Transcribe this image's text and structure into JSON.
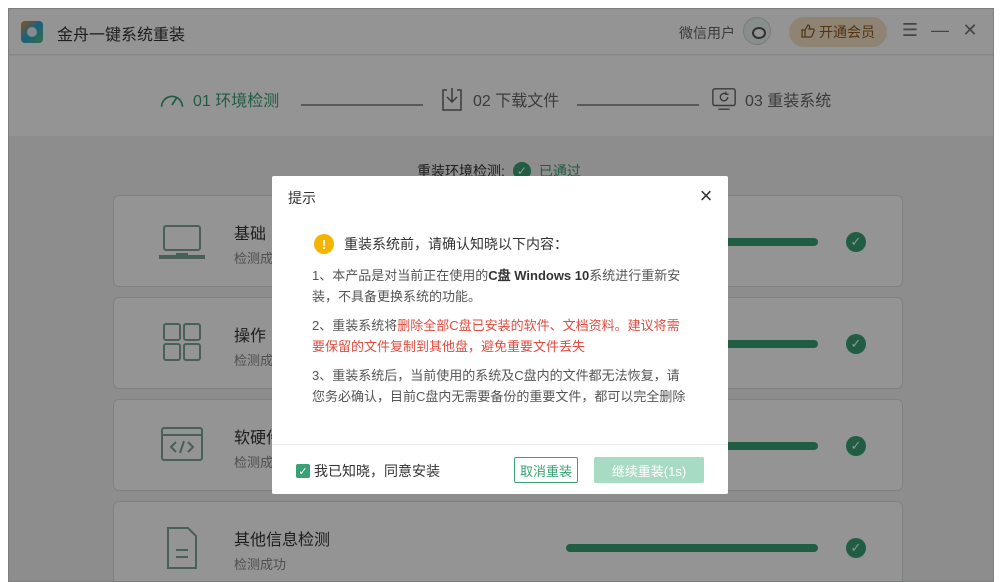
{
  "window": {
    "title": "金舟一键系统重装",
    "user_label": "微信用户",
    "vip_label": "开通会员",
    "controls": [
      "☰",
      "—",
      "✕"
    ]
  },
  "steps": [
    {
      "label": "01 环境检测",
      "icon": "speedometer-icon",
      "active": true
    },
    {
      "label": "02 下载文件",
      "icon": "download-icon",
      "active": false
    },
    {
      "label": "03 重装系统",
      "icon": "refresh-icon",
      "active": false
    }
  ],
  "detection": {
    "label": "重装环境检测:",
    "status": "已通过"
  },
  "cards": [
    {
      "title": "基础",
      "subtitle": "检测成",
      "icon": "laptop-icon",
      "progress": 1.0
    },
    {
      "title": "操作",
      "subtitle": "检测成",
      "icon": "grid-icon",
      "progress": 1.0
    },
    {
      "title": "软硬件",
      "subtitle": "检测成",
      "icon": "code-window-icon",
      "progress": 1.0
    },
    {
      "title": "其他信息检测",
      "subtitle": "检测成功",
      "icon": "document-icon",
      "progress": 1.0
    }
  ],
  "dialog": {
    "title": "提示",
    "warning": "重装系统前，请确认知晓以下内容：",
    "p1_pre": "1、本产品是对当前正在使用的",
    "p1_bold": "C盘 Windows 10",
    "p1_post": "系统进行重新安装，不具备更换系统的功能。",
    "p2_pre": "2、重装系统将",
    "p2_red": "删除全部C盘已安装的软件、文档资料。建议将需要保留的文件复制到其他盘，避免重要文件丢失",
    "p3": "3、重装系统后，当前使用的系统及C盘内的文件都无法恢复，请您务必确认，目前C盘内无需要备份的重要文件，都可以完全删除",
    "agree_label": "我已知晓，同意安装",
    "cancel_label": "取消重装",
    "continue_label": "继续重装(1s)"
  },
  "colors": {
    "accent": "#39a173",
    "warning": "#f4b400",
    "danger": "#e04b3f"
  }
}
